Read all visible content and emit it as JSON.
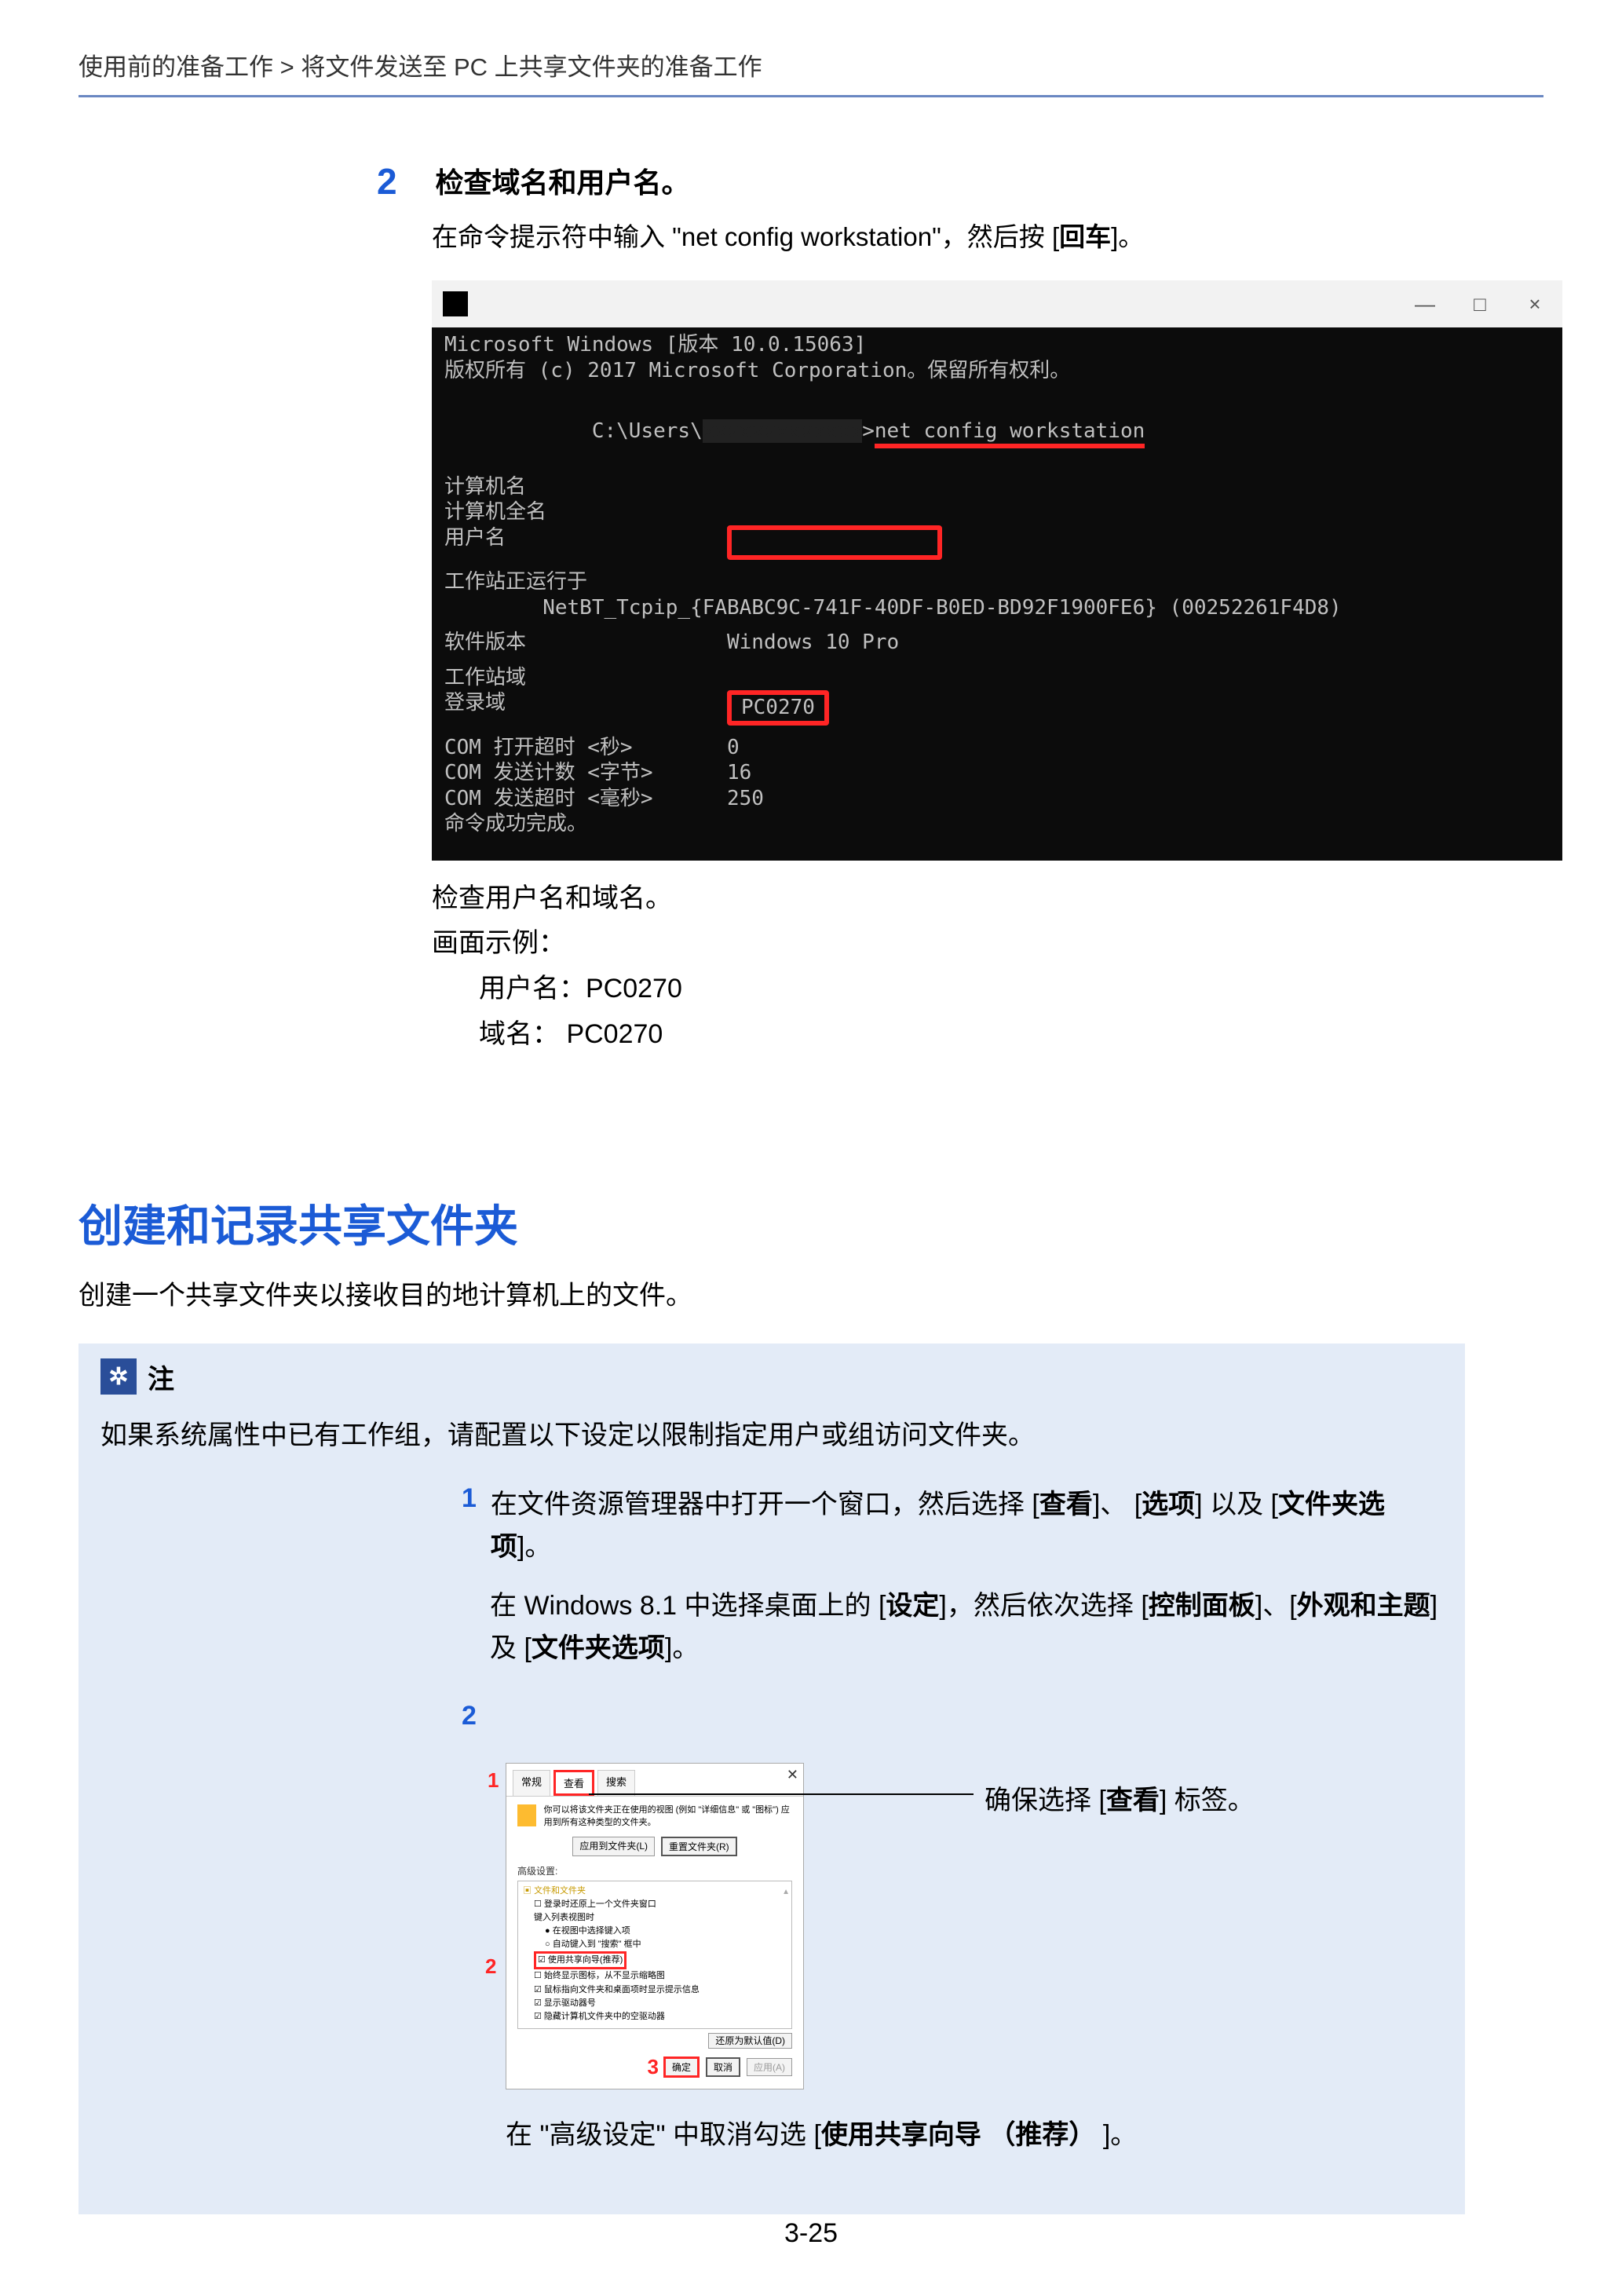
{
  "breadcrumb": "使用前的准备工作 > 将文件发送至 PC 上共享文件夹的准备工作",
  "step2": {
    "num": "2",
    "title": "检查域名和用户名。",
    "body_pre": "在命令提示符中输入 \"",
    "body_cmd": "net config workstation",
    "body_mid": "\"，然后按 [",
    "body_key": "回车",
    "body_post": "]。"
  },
  "cmd": {
    "line_version": "Microsoft Windows [版本 10.0.15063]",
    "line_copyright": "版权所有 (c) 2017 Microsoft Corporation。保留所有权利。",
    "prompt_pre": "C:\\Users\\",
    "prompt_post": ">",
    "cmd_text": "net config workstation",
    "r_compname": "计算机名",
    "r_fullname": "计算机全名",
    "r_user": "用户名",
    "r_running": "工作站正运行于",
    "r_netbt": "        NetBT_Tcpip_{FABABC9C-741F-40DF-B0ED-BD92F1900FE6} (00252261F4D8)",
    "r_soft": "软件版本",
    "v_soft": "Windows 10 Pro",
    "r_domain": "工作站域",
    "r_logon": "登录域",
    "v_logon": "PC0270",
    "r_com1": "COM 打开超时 <秒>",
    "v_com1": "0",
    "r_com2": "COM 发送计数 <字节>",
    "v_com2": "16",
    "r_com3": "COM 发送超时 <毫秒>",
    "v_com3": "250",
    "r_done": "命令成功完成。",
    "win_min": "—",
    "win_max": "□",
    "win_close": "×"
  },
  "after_cmd": {
    "l1": "检查用户名和域名。",
    "l2": "画面示例：",
    "l3": "用户名：PC0270",
    "l4": "域名：   PC0270"
  },
  "h2": "创建和记录共享文件夹",
  "h2_sub": "创建一个共享文件夹以接收目的地计算机上的文件。",
  "note": {
    "icon": "✲",
    "title": "注",
    "text": "如果系统属性中已有工作组，请配置以下设定以限制指定用户或组访问文件夹。",
    "s1_num": "1",
    "s1a": "在文件资源管理器中打开一个窗口，然后选择 [",
    "s1a_bold1": "查看",
    "s1b": "]、 [",
    "s1b_bold": "选项",
    "s1c": "] 以及 [",
    "s1c_bold": "文件夹选项",
    "s1d": "]。",
    "s1_sub_a": "在 Windows 8.1 中选择桌面上的 [",
    "s1_sub_a_bold": "设定",
    "s1_sub_b": "]，然后依次选择 [",
    "s1_sub_b_bold": "控制面板",
    "s1_sub_c": "]、[",
    "s1_sub_c_bold": "外观和主题",
    "s1_sub_d": "] 及 [",
    "s1_sub_d_bold": "文件夹选项",
    "s1_sub_e": "]。",
    "s2_num": "2",
    "callout_a": "确保选择 [",
    "callout_bold": "查看",
    "callout_b": "] 标签。",
    "post_fig_a": "在 \"高级设定\" 中取消勾选 [",
    "post_fig_bold": "使用共享向导 （推荐）",
    "post_fig_b": " ]。"
  },
  "dialog": {
    "close": "✕",
    "tab1": "常规",
    "tab2": "查看",
    "tab3": "搜索",
    "marker1": "1",
    "marker2": "2",
    "marker3": "3",
    "sec_text": "你可以将该文件夹正在使用的视图 (例如 \"详细信息\" 或 \"图标\") 应用到所有这种类型的文件夹。",
    "btn_apply_folders": "应用到文件夹(L)",
    "btn_reset_folders": "重置文件夹(R)",
    "adv_label": "高级设置:",
    "tree_root": "文件和文件夹",
    "t1": "登录时还原上一个文件夹窗口",
    "t2": "键入列表视图时",
    "t2a": "在视图中选择键入项",
    "t2b": "自动键入到 \"搜索\" 框中",
    "t3": "使用共享向导(推荐)",
    "t4": "始终显示图标，从不显示缩略图",
    "t5": "鼠标指向文件夹和桌面项时显示提示信息",
    "t6": "显示驱动器号",
    "t7": "隐藏计算机文件夹中的空驱动器",
    "btn_restore": "还原为默认值(D)",
    "btn_ok": "确定",
    "btn_cancel": "取消",
    "btn_apply": "应用(A)"
  },
  "page_num": "3-25"
}
